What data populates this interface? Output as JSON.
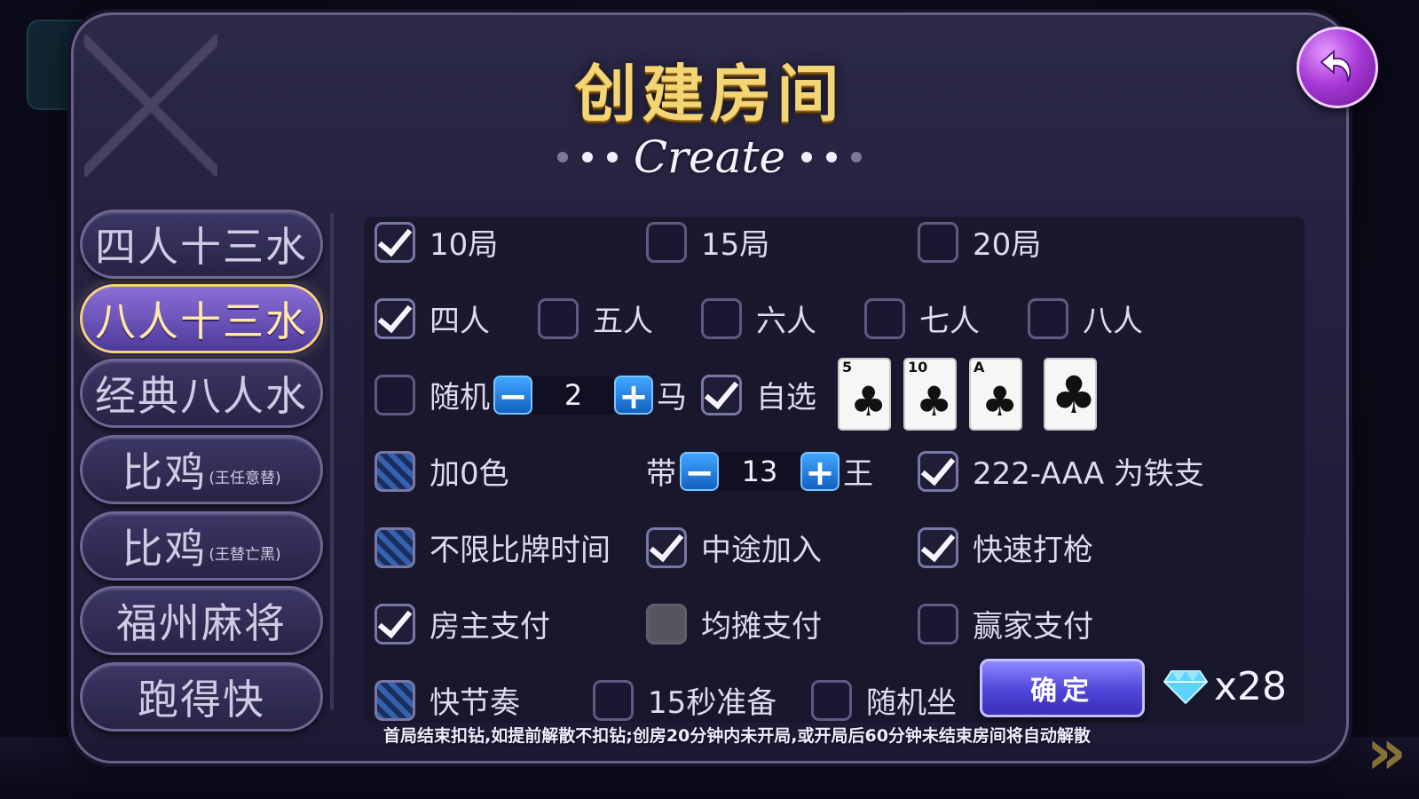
{
  "dialog": {
    "title": "创建房间",
    "subtitle": "Create"
  },
  "sidebar": {
    "items": [
      {
        "label": "四人十三水",
        "note": "",
        "active": false
      },
      {
        "label": "八人十三水",
        "note": "",
        "active": true
      },
      {
        "label": "经典八人水",
        "note": "",
        "active": false
      },
      {
        "label": "比鸡",
        "note": "(王任意替)",
        "active": false
      },
      {
        "label": "比鸡",
        "note": "(王替亡黑)",
        "active": false
      },
      {
        "label": "福州麻将",
        "note": "",
        "active": false
      },
      {
        "label": "跑得快",
        "note": "",
        "active": false
      }
    ]
  },
  "options": {
    "rounds": [
      {
        "label": "10局",
        "state": "checked"
      },
      {
        "label": "15局",
        "state": "unchecked"
      },
      {
        "label": "20局",
        "state": "unchecked"
      }
    ],
    "players": [
      {
        "label": "四人",
        "state": "checked"
      },
      {
        "label": "五人",
        "state": "unchecked"
      },
      {
        "label": "六人",
        "state": "unchecked"
      },
      {
        "label": "七人",
        "state": "unchecked"
      },
      {
        "label": "八人",
        "state": "unchecked"
      }
    ],
    "horse": {
      "random_label": "随机",
      "random_state": "unchecked",
      "minus": "−",
      "plus": "+",
      "count": "2",
      "suffix": "马",
      "custom_label": "自选",
      "custom_state": "checked",
      "cards": [
        {
          "rank": "5",
          "suit": "♣"
        },
        {
          "rank": "10",
          "suit": "♣"
        },
        {
          "rank": "A",
          "suit": "♣"
        },
        {
          "rank": "",
          "suit": "♣"
        }
      ]
    },
    "colors": {
      "label": "加0色",
      "state": "partial"
    },
    "jokers": {
      "prefix": "带",
      "minus": "−",
      "plus": "+",
      "count": "13",
      "suffix": "王"
    },
    "iron": {
      "label": "222-AAA 为铁支",
      "state": "checked"
    },
    "unlimited_time": {
      "label": "不限比牌时间",
      "state": "partial"
    },
    "join_midway": {
      "label": "中途加入",
      "state": "checked"
    },
    "fast_shoot": {
      "label": "快速打枪",
      "state": "checked"
    },
    "payment": [
      {
        "label": "房主支付",
        "state": "checked"
      },
      {
        "label": "均摊支付",
        "state": "disabled"
      },
      {
        "label": "赢家支付",
        "state": "unchecked"
      }
    ],
    "fast_pace": {
      "label": "快节奏",
      "state": "partial"
    },
    "ready15": {
      "label": "15秒准备",
      "state": "unchecked"
    },
    "random_seat": {
      "label": "随机坐",
      "state": "unchecked"
    }
  },
  "confirm_label": "确定",
  "cost": {
    "icon": "diamond-icon",
    "value": "x28"
  },
  "notice": "首局结束扣钻,如提前解散不扣钻;创房20分钟内未开局,或开局后60分钟未结束房间将自动解散",
  "colors_ui": {
    "accent_gold": "#f4d574",
    "back_button": "#a83ad8",
    "confirm": "#4f45d8",
    "stepper": "#1460c0"
  }
}
